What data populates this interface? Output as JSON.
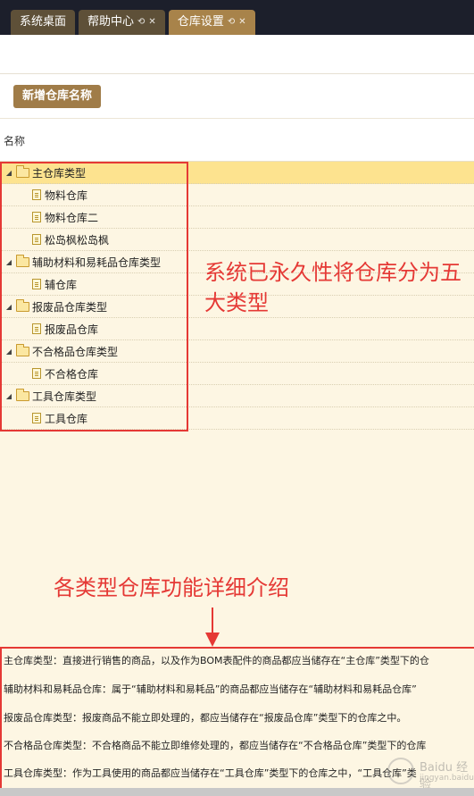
{
  "tabs": [
    {
      "label": "系统桌面",
      "active": false,
      "closable": false
    },
    {
      "label": "帮助中心",
      "active": false,
      "closable": true
    },
    {
      "label": "仓库设置",
      "active": true,
      "closable": true
    }
  ],
  "toolbar": {
    "add_label": "新增仓库名称"
  },
  "table": {
    "header_name": "名称"
  },
  "tree": [
    {
      "level": 0,
      "label": "主仓库类型",
      "selected": true
    },
    {
      "level": 1,
      "label": "物料仓库"
    },
    {
      "level": 1,
      "label": "物料仓库二"
    },
    {
      "level": 1,
      "label": "松岛枫松岛枫"
    },
    {
      "level": 0,
      "label": "辅助材料和易耗品仓库类型"
    },
    {
      "level": 1,
      "label": "辅仓库"
    },
    {
      "level": 0,
      "label": "报废品仓库类型"
    },
    {
      "level": 1,
      "label": "报废品仓库"
    },
    {
      "level": 0,
      "label": "不合格品仓库类型"
    },
    {
      "level": 1,
      "label": "不合格仓库"
    },
    {
      "level": 0,
      "label": "工具仓库类型"
    },
    {
      "level": 1,
      "label": "工具仓库"
    }
  ],
  "annotations": {
    "types_note": "系统已永久性将仓库分为五大类型",
    "detail_note": "各类型仓库功能详细介绍"
  },
  "descriptions": [
    "主仓库类型：直接进行销售的商品，以及作为BOM表配件的商品都应当储存在“主仓库”类型下的仓",
    "辅助材料和易耗品仓库：属于“辅助材料和易耗品”的商品都应当储存在“辅助材料和易耗品仓库”",
    "报废品仓库类型：报废商品不能立即处理的，都应当储存在“报废品仓库”类型下的仓库之中。",
    "不合格品仓库类型：不合格商品不能立即维修处理的，都应当储存在“不合格品仓库”类型下的仓库",
    "工具仓库类型：作为工具使用的商品都应当储存在“工具仓库”类型下的仓库之中，“工具仓库”类"
  ],
  "watermark": {
    "line1": "Baidu 经验",
    "line2": "jingyan.baidu.com"
  },
  "colors": {
    "accent": "#a8834a",
    "annotation": "#e53935",
    "selected_row": "#fde38f"
  }
}
